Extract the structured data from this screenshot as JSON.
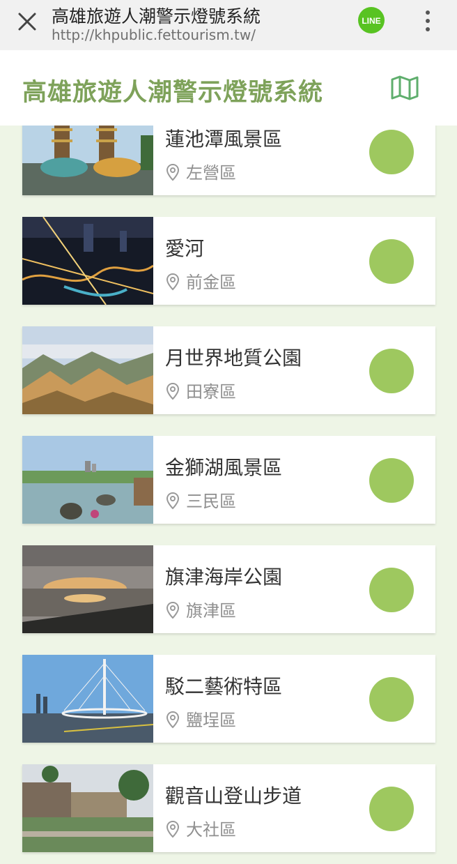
{
  "browser": {
    "page_title": "高雄旅遊人潮警示燈號系統",
    "url": "http://khpublic.fettourism.tw/",
    "line_label": "LINE"
  },
  "header": {
    "title": "高雄旅遊人潮警示燈號系統"
  },
  "colors": {
    "accent": "#7ea25a",
    "status_green": "#9ec85f",
    "background": "#eef5e6"
  },
  "locations": [
    {
      "name": "蓮池潭風景區",
      "district": "左營區",
      "status": "green"
    },
    {
      "name": "愛河",
      "district": "前金區",
      "status": "green"
    },
    {
      "name": "月世界地質公園",
      "district": "田寮區",
      "status": "green"
    },
    {
      "name": "金獅湖風景區",
      "district": "三民區",
      "status": "green"
    },
    {
      "name": "旗津海岸公園",
      "district": "旗津區",
      "status": "green"
    },
    {
      "name": "駁二藝術特區",
      "district": "鹽埕區",
      "status": "green"
    },
    {
      "name": "觀音山登山步道",
      "district": "大社區",
      "status": "green"
    }
  ]
}
